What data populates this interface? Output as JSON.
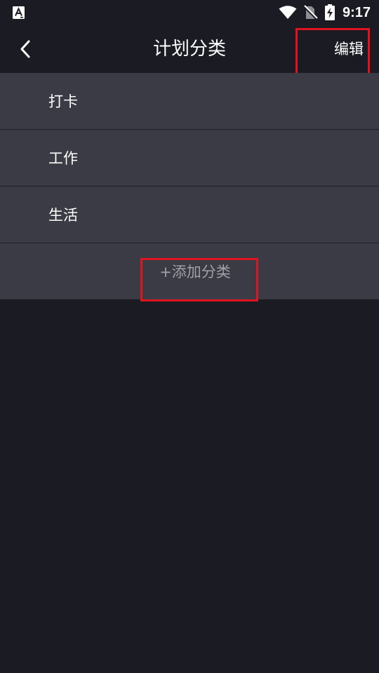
{
  "status_bar": {
    "time": "9:17",
    "icons": [
      "app-notification-icon",
      "wifi-icon",
      "no-sim-icon",
      "battery-charging-icon"
    ]
  },
  "header": {
    "title": "计划分类",
    "edit_label": "编辑",
    "back_icon": "chevron-left-icon"
  },
  "categories": [
    {
      "label": "打卡"
    },
    {
      "label": "工作"
    },
    {
      "label": "生活"
    }
  ],
  "add_category_label": "+添加分类",
  "colors": {
    "background": "#1b1b23",
    "list_item": "#3a3b44",
    "divider": "#1f1f27",
    "highlight": "#e0141e",
    "muted_text": "#a0a1a8"
  }
}
